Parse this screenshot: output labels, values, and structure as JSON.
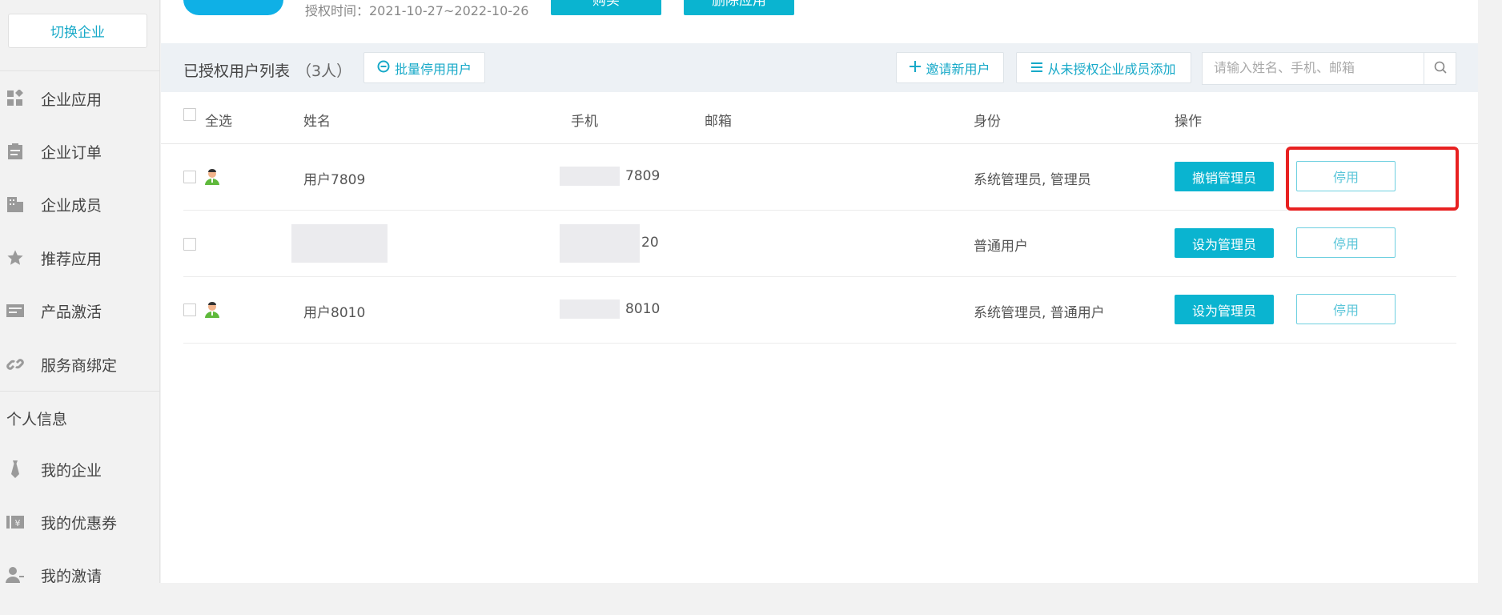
{
  "sidebar": {
    "switch_label": "切换企业",
    "items": [
      {
        "label": "企业应用",
        "icon": "apps-grid-icon"
      },
      {
        "label": "企业订单",
        "icon": "clipboard-icon"
      },
      {
        "label": "企业成员",
        "icon": "building-icon"
      },
      {
        "label": "推荐应用",
        "icon": "star-icon"
      },
      {
        "label": "产品激活",
        "icon": "card-icon"
      },
      {
        "label": "服务商绑定",
        "icon": "link-icon"
      }
    ],
    "personal_section": "个人信息",
    "personal_items": [
      {
        "label": "我的企业",
        "icon": "tie-icon"
      },
      {
        "label": "我的优惠券",
        "icon": "coupon-icon"
      },
      {
        "label": "我的激请",
        "icon": "user-invite-icon"
      }
    ]
  },
  "top": {
    "auth_time": "授权时间：2021-10-27~2022-10-26",
    "buy_label": "购买",
    "delete_label": "删除应用"
  },
  "list": {
    "title": "已授权用户列表",
    "count": "（3人）",
    "batch_disable": "批量停用用户",
    "invite": "邀请新用户",
    "add_from_unauth": "从未授权企业成员添加",
    "search_placeholder": "请输入姓名、手机、邮箱"
  },
  "table": {
    "headers": {
      "select_all": "全选",
      "name": "姓名",
      "phone": "手机",
      "email": "邮箱",
      "role": "身份",
      "actions": "操作"
    },
    "rows": [
      {
        "name": "用户7809",
        "phone_tail": "7809",
        "email": "",
        "role": "系统管理员, 管理员",
        "action": "撤销管理员",
        "disable": "停用"
      },
      {
        "name": "",
        "phone_tail": "20",
        "email": "",
        "role": "普通用户",
        "action": "设为管理员",
        "disable": "停用"
      },
      {
        "name": "用户8010",
        "phone_tail": "8010",
        "email": "",
        "role": "系统管理员, 普通用户",
        "action": "设为管理员",
        "disable": "停用"
      }
    ]
  },
  "colors": {
    "accent": "#0ab4d0",
    "highlight": "#e82121"
  }
}
